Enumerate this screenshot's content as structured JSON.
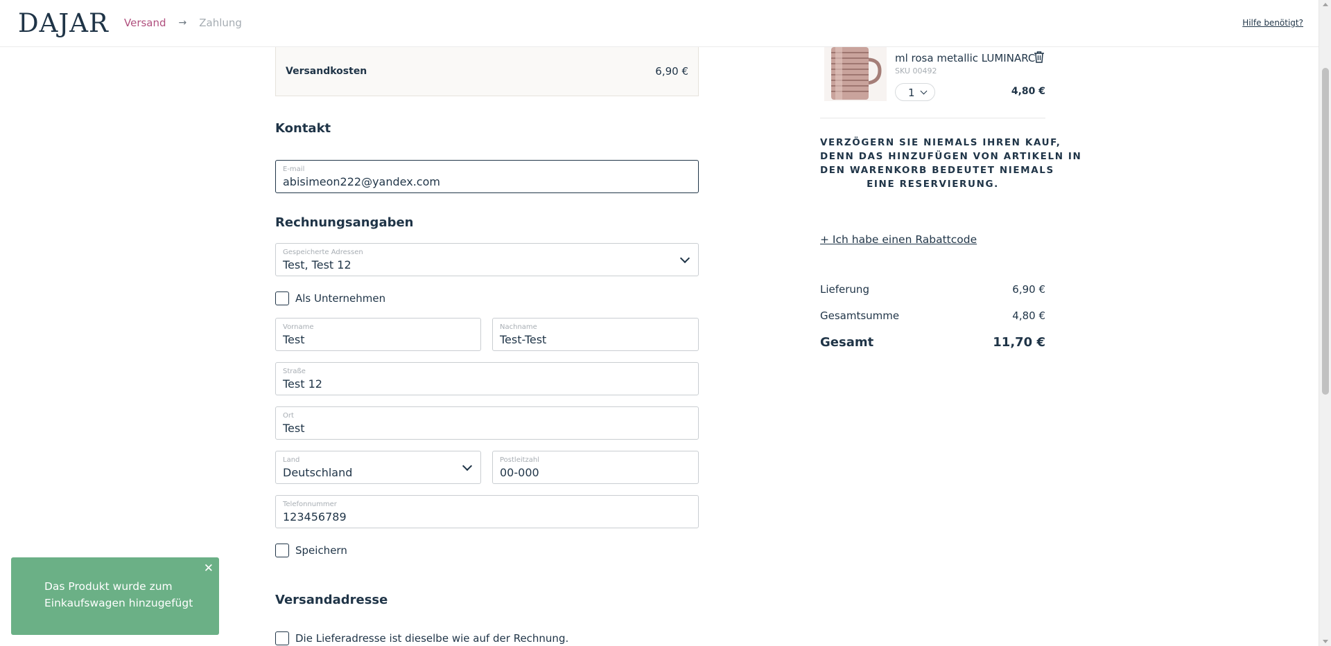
{
  "header": {
    "logo": "DAJAR",
    "step_shipping": "Versand",
    "step_arrow": "→",
    "step_payment": "Zahlung",
    "help_link": "Hilfe benötigt?"
  },
  "shipping_costs": {
    "label": "Versandkosten",
    "value": "6,90 €"
  },
  "contact": {
    "title": "Kontakt",
    "email_label": "E-mail",
    "email_value": "abisimeon222@yandex.com"
  },
  "billing": {
    "title": "Rechnungsangaben",
    "saved_label": "Gespeicherte Adressen",
    "saved_value": "Test, Test 12",
    "company_label": "Als Unternehmen",
    "firstname_label": "Vorname",
    "firstname_value": "Test",
    "lastname_label": "Nachname",
    "lastname_value": "Test-Test",
    "street_label": "Straße",
    "street_value": "Test 12",
    "city_label": "Ort",
    "city_value": "Test",
    "country_label": "Land",
    "country_value": "Deutschland",
    "zip_label": "Postleitzahl",
    "zip_value": "00-000",
    "phone_label": "Telefonnummer",
    "phone_value": "123456789",
    "save_label": "Speichern"
  },
  "delivery": {
    "title": "Versandadresse",
    "same_label": "Die Lieferadresse ist dieselbe wie auf der Rechnung."
  },
  "cart": {
    "product_name": "ml rosa metallic LUMINARC",
    "product_sku": "SKU 00492",
    "quantity": "1",
    "price": "4,80 €",
    "notice_lines": [
      "VERZÖGERN SIE NIEMALS IHREN KAUF,",
      "DENN DAS HINZUFÜGEN VON ARTIKELN IN",
      "DEN WARENKORB BEDEUTET NIEMALS",
      "EINE RESERVIERUNG."
    ],
    "coupon_link": "+ Ich habe einen Rabattcode",
    "delivery_label": "Lieferung",
    "delivery_value": "6,90 €",
    "subtotal_label": "Gesamtsumme",
    "subtotal_value": "4,80 €",
    "total_label": "Gesamt",
    "total_value": "11,70 €"
  },
  "toast": {
    "message": "Das Produkt wurde zum Einkaufswagen hinzugefügt",
    "close": "✕"
  },
  "icons": {
    "trash": "trash-icon",
    "chevron": "chevron-down-icon",
    "close": "close-icon"
  },
  "colors": {
    "primary_text": "#1f3447",
    "accent_step": "#b0507e",
    "toast_bg": "#6bb086"
  }
}
